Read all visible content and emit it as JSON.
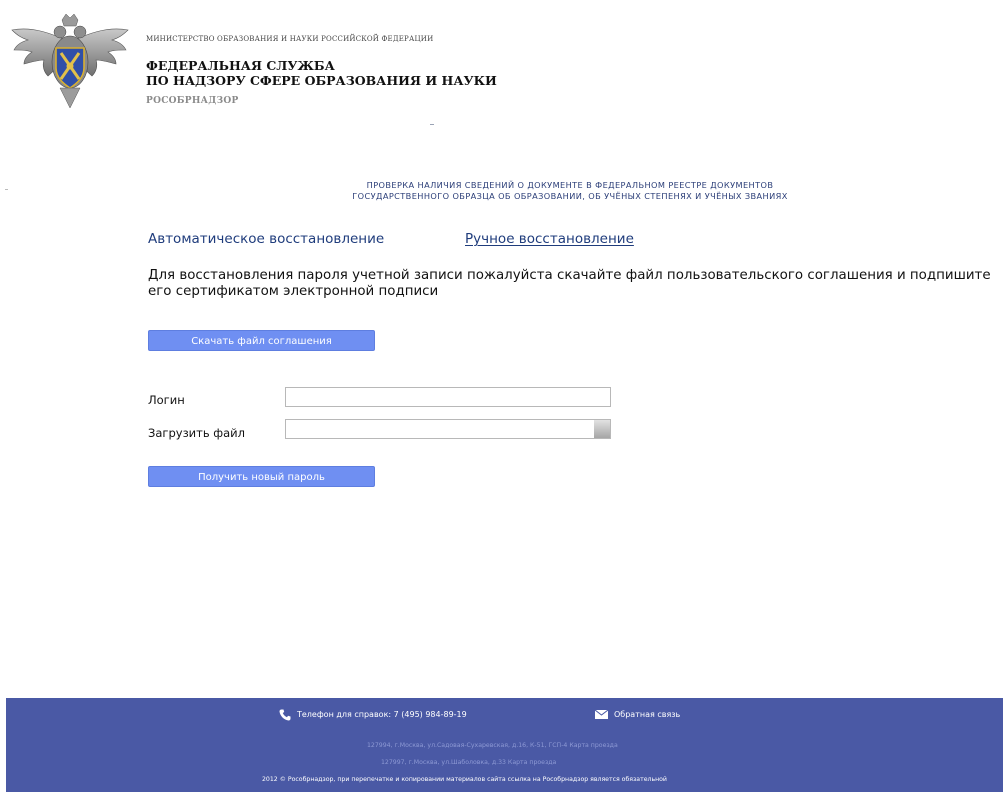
{
  "header": {
    "ministry": "МИНИСТЕРСТВО ОБРАЗОВАНИЯ И НАУКИ РОССИЙСКОЙ ФЕДЕРАЦИИ",
    "service_line1": "ФЕДЕРАЛЬНАЯ СЛУЖБА",
    "service_line2": "ПО НАДЗОРУ СФЕРЕ ОБРАЗОВАНИЯ И НАУКИ",
    "short_name": "РОСОБРНАДЗОР",
    "emblem_icon": "double-headed-eagle-emblem-icon"
  },
  "heading": {
    "line1": "ПРОВЕРКА НАЛИЧИЯ СВЕДЕНИЙ О ДОКУМЕНТЕ В ФЕДЕРАЛЬНОМ РЕЕСТРЕ ДОКУМЕНТОВ",
    "line2": "ГОСУДАРСТВЕННОГО ОБРАЗЦА ОБ ОБРАЗОВАНИИ, ОБ УЧЁНЫХ СТЕПЕНЯХ И УЧЁНЫХ ЗВАНИЯХ"
  },
  "tabs": {
    "auto": "Автоматическое восстановление",
    "manual": "Ручное восстановление"
  },
  "instruction": "Для восстановления пароля учетной записи пожалуйста скачайте файл пользовательского соглашения и подпишите его сертификатом электронной подписи",
  "form": {
    "download_button": "Скачать файл соглашения",
    "login_label": "Логин",
    "login_value": "",
    "file_label": "Загрузить файл",
    "submit_button": "Получить новый пароль"
  },
  "footer": {
    "phone": "Телефон для справок: 7 (495) 984-89-19",
    "feedback": "Обратная связь",
    "address1": "127994, г.Москва, ул.Садовая-Сухаревская, д.16, К-51, ГСП-4  Карта проезда",
    "address2": "127997, г.Москва, ул.Шаболовка, д.33  Карта проезда",
    "copyright": "2012 © Рособрнадзор, при перепечатке и копировании материалов сайта ссылка на Рособрнадзор является обязательной",
    "phone_icon": "phone-icon",
    "mail_icon": "mail-icon"
  },
  "colors": {
    "accent_blue": "#1f3c7c",
    "button_blue": "#6f8ff2",
    "footer_bg": "#4a59a5"
  }
}
